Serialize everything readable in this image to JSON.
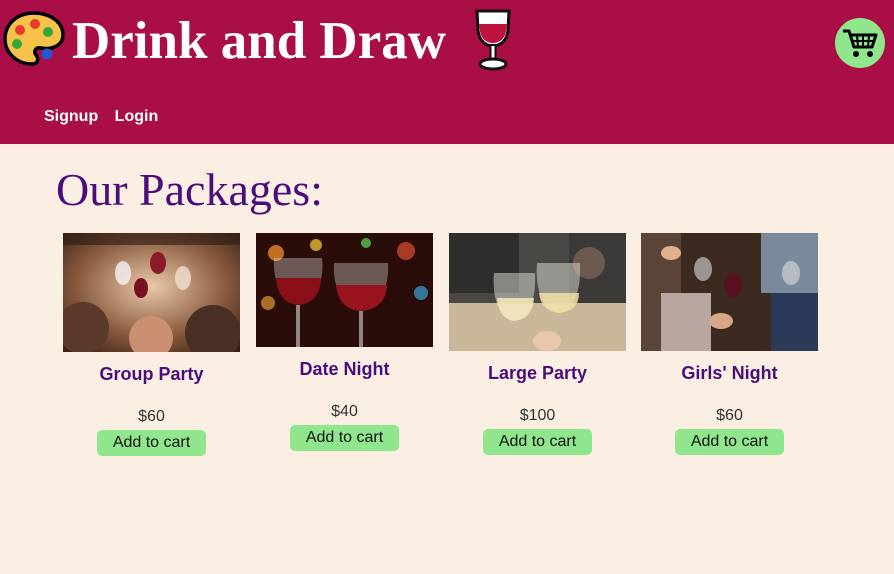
{
  "header": {
    "title": "Drink and Draw",
    "cart_icon": "shopping-cart-icon",
    "palette_icon": "artist-palette-icon",
    "wine_icon": "wine-glass-icon",
    "brand_color": "#aa0e46",
    "accent_color": "#8fe68c"
  },
  "nav": {
    "signup": "Signup",
    "login": "Login"
  },
  "main": {
    "title": "Our Packages:",
    "packages": [
      {
        "name": "Group Party",
        "price": "$60",
        "button": "Add to cart"
      },
      {
        "name": "Date Night",
        "price": "$40",
        "button": "Add to cart"
      },
      {
        "name": "Large Party",
        "price": "$100",
        "button": "Add to cart"
      },
      {
        "name": "Girls' Night",
        "price": "$60",
        "button": "Add to cart"
      }
    ]
  }
}
